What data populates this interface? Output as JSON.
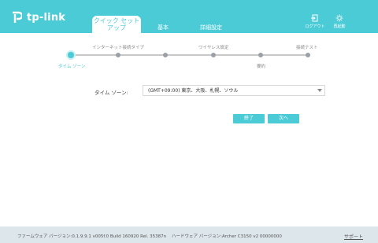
{
  "header": {
    "brand": "tp-link",
    "tabs": [
      {
        "label": "クイック セット\nアップ",
        "active": true
      },
      {
        "label": "基本",
        "active": false
      },
      {
        "label": "詳細設定",
        "active": false
      }
    ],
    "logout_label": "ログアウト",
    "reboot_label": "再起動",
    "accent_color": "#4acbd6"
  },
  "steps": [
    {
      "label": "タイム ゾーン",
      "active": true
    },
    {
      "label": "インターネット接続タイプ",
      "active": false
    },
    {
      "label": "",
      "active": false
    },
    {
      "label": "ワイヤレス設定",
      "active": false
    },
    {
      "label": "要約",
      "active": false
    },
    {
      "label": "接続テスト",
      "active": false
    }
  ],
  "form": {
    "timezone_label": "タイム ゾーン:",
    "timezone_value": "(GMT+09:00) 東京、大阪、札幌、ソウル"
  },
  "buttons": {
    "exit_label": "終了",
    "next_label": "次へ"
  },
  "footer": {
    "firmware": "ファームウェア バージョン:0.1.9.9.1 v005f.0 Build 160920 Rel. 35387n",
    "hardware": "ハードウェア バージョン:Archer C3150 v2 00000000",
    "support_label": "サポート"
  }
}
